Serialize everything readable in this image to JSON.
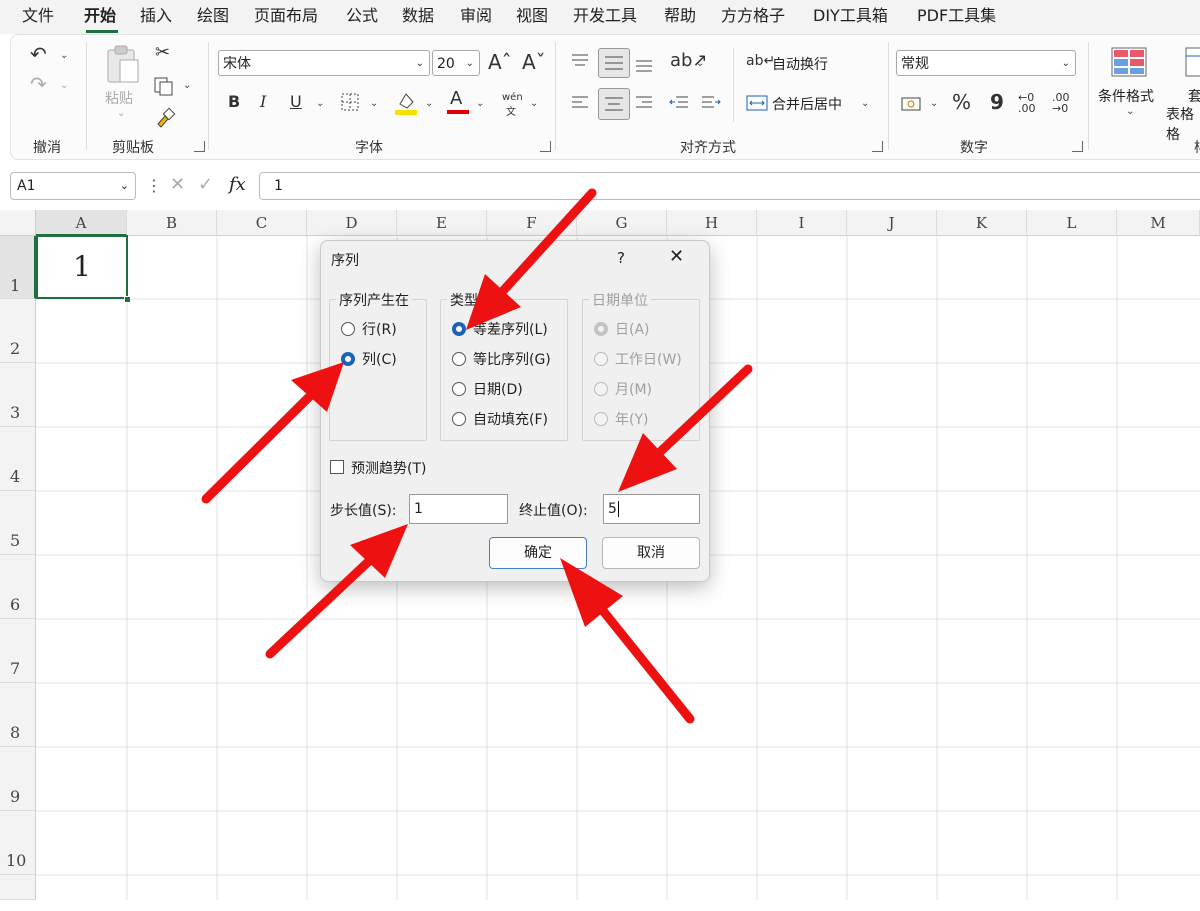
{
  "menu": {
    "items": [
      "文件",
      "开始",
      "插入",
      "绘图",
      "页面布局",
      "公式",
      "数据",
      "审阅",
      "视图",
      "开发工具",
      "帮助",
      "方方格子",
      "DIY工具箱",
      "PDF工具集"
    ],
    "active": "开始"
  },
  "ribbon": {
    "groups": {
      "undo": "撤消",
      "clipboard": "剪贴板",
      "font": "字体",
      "align": "对齐方式",
      "number": "数字"
    },
    "paste_label": "粘贴",
    "font_name": "宋体",
    "font_size": "20",
    "wrap_text": "自动换行",
    "merge_center": "合并后居中",
    "number_format": "常规",
    "cond_format": "条件格式",
    "table_format_partial": "套",
    "table_format_partial2": "表格格",
    "extra_group_partial": "样",
    "bold": "B",
    "italic": "I",
    "underline": "U",
    "font_color_glyph": "A",
    "pinyin_top": "wén",
    "pinyin_bottom": "文",
    "percent": "%",
    "comma": "9",
    "inc_decimal": ".00",
    "dec_decimal": ".00",
    "font_color": "#e00000",
    "highlight_color": "#f5e000"
  },
  "formula_bar": {
    "name_box": "A1",
    "fx": "fx",
    "value": "1"
  },
  "sheet": {
    "columns": [
      "A",
      "B",
      "C",
      "D",
      "E",
      "F",
      "G",
      "H",
      "I",
      "J",
      "K",
      "L",
      "M"
    ],
    "rows": [
      "1",
      "2",
      "3",
      "4",
      "5",
      "6",
      "7",
      "8",
      "9",
      "10"
    ],
    "a1": "1"
  },
  "dialog": {
    "title": "序列",
    "help": "?",
    "series_in": {
      "legend": "序列产生在",
      "options": [
        "行(R)",
        "列(C)"
      ],
      "selected": "列(C)"
    },
    "type": {
      "legend": "类型",
      "options": [
        "等差序列(L)",
        "等比序列(G)",
        "日期(D)",
        "自动填充(F)"
      ],
      "selected": "等差序列(L)"
    },
    "date_unit": {
      "legend": "日期单位",
      "options": [
        "日(A)",
        "工作日(W)",
        "月(M)",
        "年(Y)"
      ],
      "selected": "日(A)"
    },
    "trend_label": "预测趋势(T)",
    "step_label": "步长值(S):",
    "step_value": "1",
    "stop_label": "终止值(O):",
    "stop_value": "5",
    "ok": "确定",
    "cancel": "取消"
  },
  "colors": {
    "accent_green": "#1e6e3e",
    "radio_blue": "#1a63b8",
    "annotation_red": "#ee1111"
  }
}
